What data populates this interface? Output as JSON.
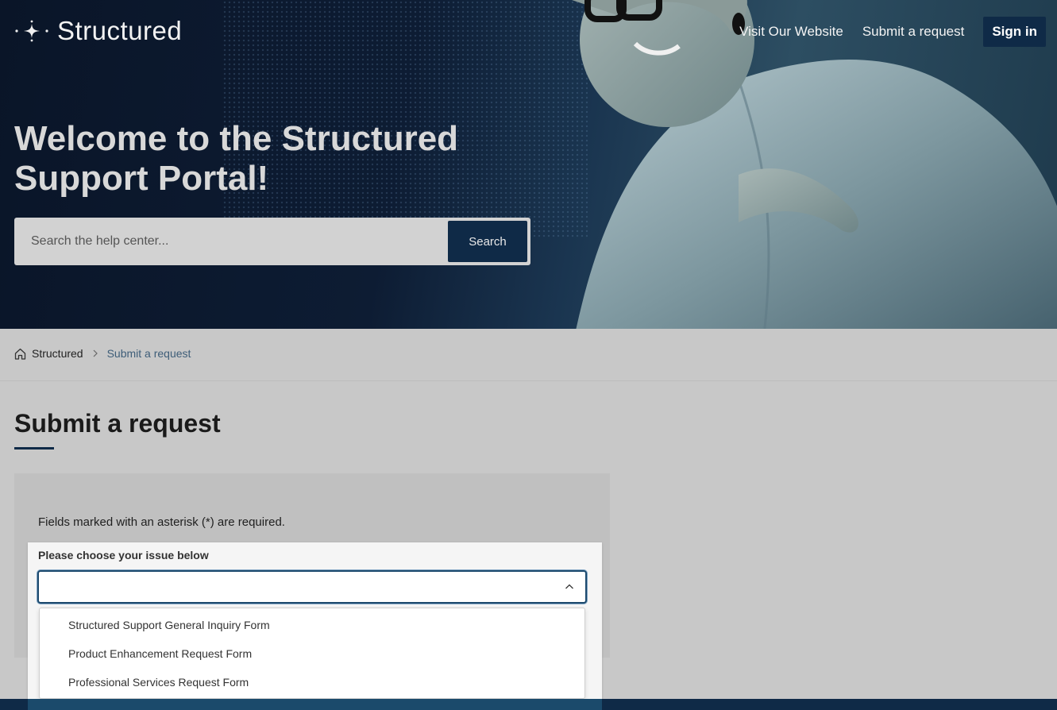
{
  "brand": {
    "name": "Structured"
  },
  "nav": {
    "visit_website": "Visit Our Website",
    "submit_request": "Submit a request",
    "sign_in": "Sign in"
  },
  "hero": {
    "headline": "Welcome to the Structured Support Portal!",
    "search_placeholder": "Search the help center...",
    "search_button": "Search"
  },
  "breadcrumb": {
    "root": "Structured",
    "current": "Submit a request"
  },
  "page": {
    "title": "Submit a request",
    "required_note": "Fields marked with an asterisk (*) are required.",
    "issue_label": "Please choose your issue below",
    "issue_value": "",
    "issue_options": [
      "Structured Support General Inquiry Form",
      "Product Enhancement Request Form",
      "Professional Services Request Form"
    ]
  },
  "colors": {
    "navy": "#0f2a47",
    "breadcrumb_current": "#3e5d78",
    "page_bg": "#c8c8c8"
  },
  "icons": {
    "logo": "sparkle-icon",
    "breadcrumb_home": "home-icon",
    "breadcrumb_sep": "chevron-right-icon",
    "select_toggle": "chevron-up-icon"
  }
}
